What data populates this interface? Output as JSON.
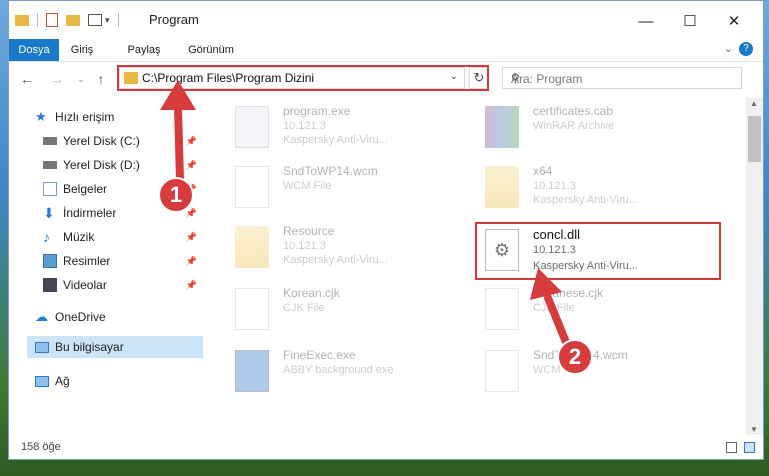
{
  "window": {
    "title": "Program"
  },
  "ribbon": {
    "tabs": [
      "Dosya",
      "Giriş",
      "Paylaş",
      "Görünüm"
    ]
  },
  "nav": {
    "address": "C:\\Program Files\\Program Dizini",
    "search_placeholder": "Ara: Program"
  },
  "sidebar": {
    "items": [
      {
        "label": "Hızlı erişim",
        "icon": "star-icon"
      },
      {
        "label": "Yerel Disk (C:)",
        "icon": "drive-icon"
      },
      {
        "label": "Yerel Disk (D:)",
        "icon": "drive-icon"
      },
      {
        "label": "Belgeler",
        "icon": "documents-icon"
      },
      {
        "label": "İndirmeler",
        "icon": "download-icon"
      },
      {
        "label": "Müzik",
        "icon": "music-icon"
      },
      {
        "label": "Resimler",
        "icon": "pictures-icon"
      },
      {
        "label": "Videolar",
        "icon": "videos-icon"
      },
      {
        "label": "OneDrive",
        "icon": "cloud-icon"
      },
      {
        "label": "Bu bilgisayar",
        "icon": "computer-icon"
      },
      {
        "label": "Ağ",
        "icon": "network-icon"
      }
    ]
  },
  "files": [
    {
      "name": "program.exe",
      "line1": "10.121.3",
      "line2": "Kaspersky Anti-Viru..."
    },
    {
      "name": "certificates.cab",
      "line1": "WinRAR Archive",
      "line2": ""
    },
    {
      "name": "SndToWP14.wcm",
      "line1": "WCM File",
      "line2": ""
    },
    {
      "name": "x64",
      "line1": "10.121.3",
      "line2": "Kaspersky Anti-Viru..."
    },
    {
      "name": "Resource",
      "line1": "10.121.3",
      "line2": "Kaspersky Anti-Viru..."
    },
    {
      "name": "concl.dll",
      "line1": "10.121.3",
      "line2": "Kaspersky Anti-Viru..."
    },
    {
      "name": "Korean.cjk",
      "line1": "CJK File",
      "line2": ""
    },
    {
      "name": "Japanese.cjk",
      "line1": "CJK File",
      "line2": ""
    },
    {
      "name": "FineExec.exe",
      "line1": "ABBY background exe",
      "line2": ""
    },
    {
      "name": "SndToWP14.wcm",
      "line1": "WCM File",
      "line2": ""
    }
  ],
  "annotations": {
    "step1": "1",
    "step2": "2"
  },
  "status": {
    "count": "158 öğe"
  },
  "colors": {
    "accent": "#1979ca",
    "highlight": "#d23a3a"
  }
}
